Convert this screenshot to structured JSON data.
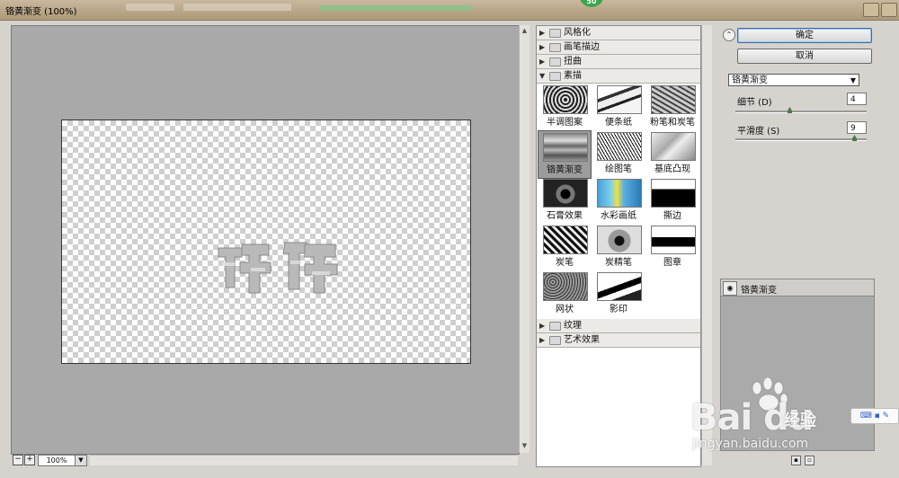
{
  "window": {
    "title": "铬黄渐变 (100%)",
    "badge": "50"
  },
  "preview": {
    "zoom": "100%",
    "zoom_out": "−",
    "zoom_in": "+"
  },
  "gallery": {
    "categories_top": [
      {
        "label": "风格化",
        "expanded": false
      },
      {
        "label": "画笔描边",
        "expanded": false
      },
      {
        "label": "扭曲",
        "expanded": false
      },
      {
        "label": "素描",
        "expanded": true
      }
    ],
    "filters": [
      "半调图案",
      "便条纸",
      "粉笔和炭笔",
      "铬黄渐变",
      "绘图笔",
      "基底凸现",
      "石膏效果",
      "水彩画纸",
      "撕边",
      "炭笔",
      "炭精笔",
      "图章",
      "网状",
      "影印"
    ],
    "selected_filter": "铬黄渐变",
    "categories_bottom": [
      {
        "label": "纹理",
        "expanded": false
      },
      {
        "label": "艺术效果",
        "expanded": false
      }
    ]
  },
  "actions": {
    "ok_label": "确定",
    "cancel_label": "取消"
  },
  "settings": {
    "filter_select": "铬黄渐变",
    "detail_label": "细节 (D)",
    "detail_value": "4",
    "smooth_label": "平滑度 (S)",
    "smooth_value": "9"
  },
  "layers": {
    "items": [
      {
        "name": "铬黄渐变"
      }
    ]
  },
  "watermark": {
    "brand": "Bai du",
    "jingyan": "经验",
    "url": "jingyan.baidu.com"
  }
}
